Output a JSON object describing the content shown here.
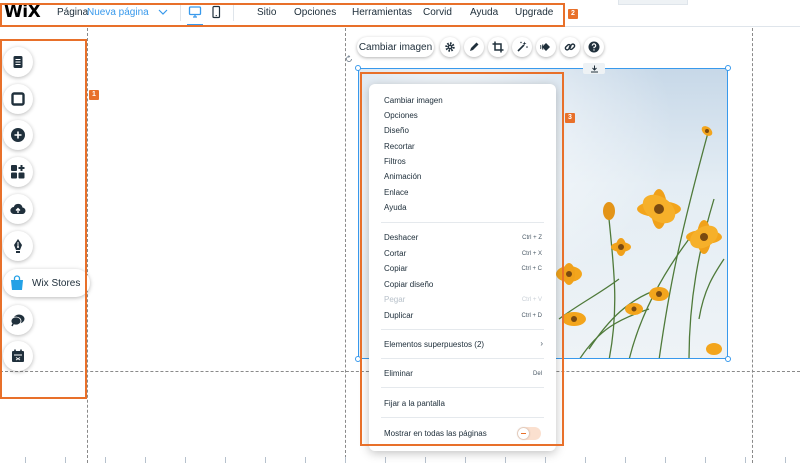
{
  "brand": {
    "logo": "WiX",
    "accent": "#3899ec",
    "annotation_color": "#e8702a"
  },
  "header": {
    "page_label": "Página",
    "page_name": "Nueva página",
    "menu": [
      "Sitio",
      "Opciones",
      "Herramientas",
      "Corvid",
      "Ayuda",
      "Upgrade"
    ],
    "devices": [
      "desktop-icon",
      "mobile-icon"
    ]
  },
  "annotations": [
    "1",
    "2",
    "3"
  ],
  "sidebar": {
    "tools": [
      "pages-icon",
      "background-icon",
      "add-icon",
      "apps-icon",
      "upload-icon",
      "pen-icon",
      "chat-icon",
      "bookings-icon"
    ],
    "stores_label": "Wix Stores"
  },
  "image_toolbar": {
    "change_image": "Cambiar imagen",
    "icons": [
      "settings-icon",
      "edit-icon",
      "crop-icon",
      "enhance-icon",
      "animation-icon",
      "link-icon",
      "help-icon"
    ]
  },
  "context_menu": {
    "group1": [
      "Cambiar imagen",
      "Opciones",
      "Diseño",
      "Recortar",
      "Filtros",
      "Animación",
      "Enlace",
      "Ayuda"
    ],
    "group2": [
      {
        "label": "Deshacer",
        "shortcut": "Ctrl + Z",
        "enabled": true
      },
      {
        "label": "Cortar",
        "shortcut": "Ctrl + X",
        "enabled": true
      },
      {
        "label": "Copiar",
        "shortcut": "Ctrl + C",
        "enabled": true
      },
      {
        "label": "Copiar diseño",
        "shortcut": "",
        "enabled": true
      },
      {
        "label": "Pegar",
        "shortcut": "Ctrl + V",
        "enabled": false
      },
      {
        "label": "Duplicar",
        "shortcut": "Ctrl + D",
        "enabled": true
      }
    ],
    "overlap": {
      "label": "Elementos superpuestos (2)",
      "arrow": "›"
    },
    "delete": {
      "label": "Eliminar",
      "shortcut": "Del"
    },
    "pin": "Fijar a la pantalla",
    "show_all": {
      "label": "Mostrar en todas las páginas",
      "enabled": false
    }
  }
}
